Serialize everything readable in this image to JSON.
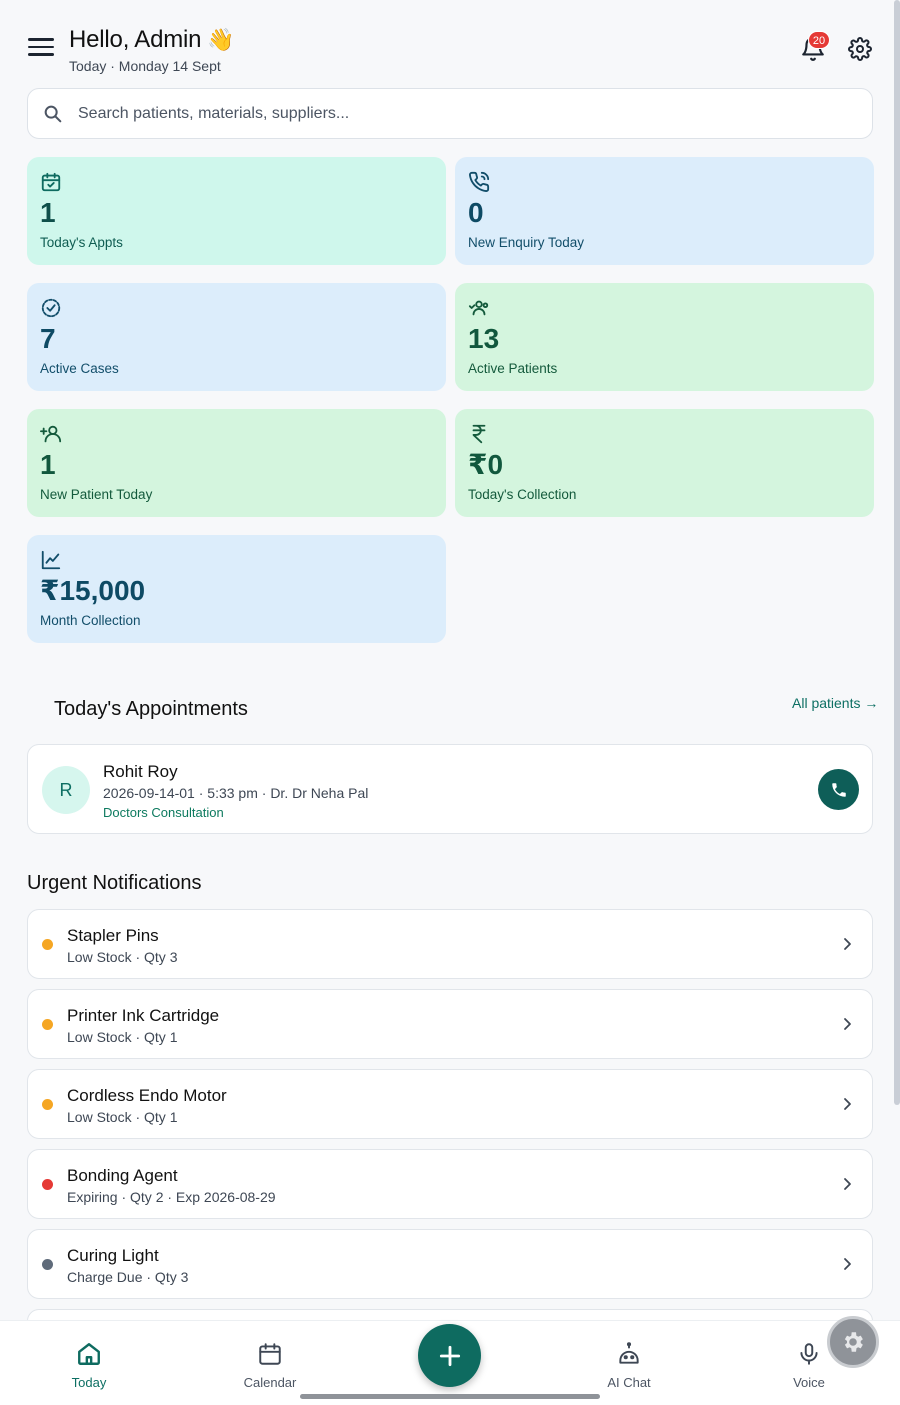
{
  "header": {
    "greeting": "Hello, Admin",
    "greeting_emoji": "👋",
    "date_line": "Today · Monday 14 Sept",
    "notification_count": "20"
  },
  "search": {
    "placeholder": "Search patients, materials, suppliers..."
  },
  "stats": [
    {
      "value": "1",
      "label": "Today's Appts",
      "icon": "calendar-check-icon"
    },
    {
      "value": "0",
      "label": "New Enquiry Today",
      "icon": "phone-call-icon"
    },
    {
      "value": "7",
      "label": "Active Cases",
      "icon": "badge-check-icon"
    },
    {
      "value": "13",
      "label": "Active Patients",
      "icon": "users-icon"
    },
    {
      "value": "1",
      "label": "New Patient Today",
      "icon": "user-plus-icon"
    },
    {
      "value": "₹0",
      "label": "Today's Collection",
      "icon": "rupee-icon"
    },
    {
      "value": "₹15,000",
      "label": "Month Collection",
      "icon": "line-chart-icon"
    }
  ],
  "appointments": {
    "title": "Today's Appointments",
    "all_link": "All patients →",
    "items": [
      {
        "initial": "R",
        "name": "Rohit Roy",
        "meta": "2026-09-14-01 · 5:33 pm · Dr. Dr Neha Pal",
        "type": "Doctors Consultation"
      }
    ]
  },
  "notifications": {
    "title": "Urgent Notifications",
    "items": [
      {
        "title": "Stapler Pins",
        "subtitle": "Low Stock · Qty 3",
        "color": "#f5a623"
      },
      {
        "title": "Printer Ink Cartridge",
        "subtitle": "Low Stock · Qty 1",
        "color": "#f5a623"
      },
      {
        "title": "Cordless Endo Motor",
        "subtitle": "Low Stock · Qty 1",
        "color": "#f5a623"
      },
      {
        "title": "Bonding Agent",
        "subtitle": "Expiring · Qty 2 · Exp 2026-08-29",
        "color": "#e53935"
      },
      {
        "title": "Curing Light",
        "subtitle": "Charge Due · Qty 3",
        "color": "#5f6b7a"
      }
    ]
  },
  "bottom_nav": {
    "today": "Today",
    "calendar": "Calendar",
    "ai_chat": "AI Chat",
    "voice": "Voice"
  },
  "colors": {
    "accent": "#0e6b60",
    "card_mint": "#cff7ec",
    "card_blue": "#dcedfb",
    "card_green": "#d4f5de"
  }
}
